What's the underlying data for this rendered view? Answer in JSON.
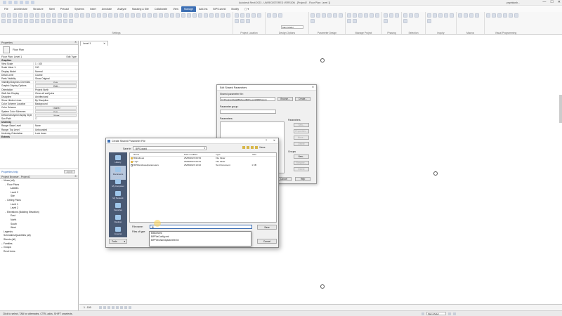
{
  "titlebar": {
    "title": "Autodesk Revit 2023 - UNREGISTERED VERSION - [Project2 - Floor Plan: Level 1]",
    "user": "pspinkosh...",
    "win_min": "—",
    "win_max": "☐",
    "win_close": "✕"
  },
  "ribbon_tabs": [
    "File",
    "Architecture",
    "Structure",
    "Steel",
    "Precast",
    "Systems",
    "Insert",
    "Annotate",
    "Analyze",
    "Massing & Site",
    "Collaborate",
    "View",
    "Manage",
    "Add-Ins",
    "BIPS-world",
    "Modify",
    "▢ ▾"
  ],
  "ribbon_active_tab": "Manage",
  "ribbon_groups": [
    {
      "label": "Settings"
    },
    {
      "label": "Project Location"
    },
    {
      "label": "Design Options"
    },
    {
      "label": "Parameter Design"
    },
    {
      "label": "Manage Project"
    },
    {
      "label": "Phasing"
    },
    {
      "label": "Selection"
    },
    {
      "label": "Inquiry"
    },
    {
      "label": "Macros"
    },
    {
      "label": "Visual Programming"
    }
  ],
  "ribbon_main_model": "Main Model",
  "properties": {
    "header": "Properties",
    "close": "✕",
    "type_name": "Floor Plan",
    "filter": "Floor Plan: Level 1",
    "edit_type": "Edit Type",
    "rows": [
      {
        "k": "Graphics",
        "v": "",
        "cat": true
      },
      {
        "k": "View Scale",
        "v": "1 : 100"
      },
      {
        "k": "Scale Value 1:",
        "v": "100"
      },
      {
        "k": "Display Model",
        "v": "Normal"
      },
      {
        "k": "Detail Level",
        "v": "Coarse"
      },
      {
        "k": "Parts Visibility",
        "v": "Show Original"
      },
      {
        "k": "Visibility/Graphics Overrides",
        "v": "Edit...",
        "btn": true
      },
      {
        "k": "Graphic Display Options",
        "v": "Edit...",
        "btn": true
      },
      {
        "k": "Orientation",
        "v": "Project North"
      },
      {
        "k": "Wall Join Display",
        "v": "Clean all wall joins"
      },
      {
        "k": "Discipline",
        "v": "Architectural"
      },
      {
        "k": "Show Hidden Lines",
        "v": "By Discipline"
      },
      {
        "k": "Color Scheme Location",
        "v": "Background"
      },
      {
        "k": "Color Scheme",
        "v": "<none>",
        "btn": true
      },
      {
        "k": "System Color Schemes",
        "v": "Edit...",
        "btn": true
      },
      {
        "k": "Default Analysis Display Style",
        "v": "None",
        "btn": true
      },
      {
        "k": "Sun Path",
        "v": "☐"
      },
      {
        "k": "Underlay",
        "v": "",
        "cat": true
      },
      {
        "k": "Range: Base Level",
        "v": "None"
      },
      {
        "k": "Range: Top Level",
        "v": "Unbounded"
      },
      {
        "k": "Underlay Orientation",
        "v": "Look down"
      },
      {
        "k": "Extents",
        "v": "",
        "cat": true
      }
    ],
    "help": "Properties help",
    "apply": "Apply"
  },
  "browser": {
    "header": "Project Browser - Project2",
    "close": "✕",
    "nodes": [
      {
        "t": "Views (all)",
        "d": 0,
        "g": "−"
      },
      {
        "t": "Floor Plans",
        "d": 1,
        "g": "−"
      },
      {
        "t": "Level 1",
        "d": 2,
        "g": "",
        "bold": true
      },
      {
        "t": "Level 2",
        "d": 2,
        "g": ""
      },
      {
        "t": "Site",
        "d": 2,
        "g": ""
      },
      {
        "t": "Ceiling Plans",
        "d": 1,
        "g": "−"
      },
      {
        "t": "Level 1",
        "d": 2,
        "g": ""
      },
      {
        "t": "Level 2",
        "d": 2,
        "g": ""
      },
      {
        "t": "Elevations (Building Elevation)",
        "d": 1,
        "g": "−"
      },
      {
        "t": "East",
        "d": 2,
        "g": ""
      },
      {
        "t": "North",
        "d": 2,
        "g": ""
      },
      {
        "t": "South",
        "d": 2,
        "g": ""
      },
      {
        "t": "West",
        "d": 2,
        "g": ""
      },
      {
        "t": "Legends",
        "d": 0,
        "g": ""
      },
      {
        "t": "Schedules/Quantities (all)",
        "d": 0,
        "g": ""
      },
      {
        "t": "Sheets (all)",
        "d": 0,
        "g": ""
      },
      {
        "t": "Families",
        "d": 0,
        "g": "+"
      },
      {
        "t": "Groups",
        "d": 0,
        "g": "+"
      },
      {
        "t": "Revit Links",
        "d": 0,
        "g": ""
      }
    ]
  },
  "view_tab": {
    "label": "Level 1",
    "close": "✕"
  },
  "viewbar": {
    "scale": "1 : 100"
  },
  "statusbar": {
    "message": "Click to select, TAB for alternates, CTRL adds, SHIFT unselects.",
    "model": "Main Model"
  },
  "edit_shared": {
    "title": "Edit Shared Parameters",
    "close": "✕",
    "file_label": "Shared parameter file:",
    "file_value": "C:\\ProgramData\\BIMsoupBIPs-world\\BIPs\\mm\\",
    "browse": "Browse...",
    "create": "Create...",
    "group_label": "Parameter group:",
    "params_label": "Parameters:",
    "parameters_section": "Parameters",
    "btn_new": "New...",
    "btn_properties": "Properties...",
    "btn_move": "Move...",
    "btn_delete": "Delete",
    "groups_section": "Groups",
    "btn_gnew": "New...",
    "btn_rename": "Rename...",
    "btn_gdelete": "Delete",
    "cancel": "Cancel",
    "help": "Help"
  },
  "create_file": {
    "title": "Create Shared Parameter File",
    "help": "?",
    "close": "✕",
    "save_in_label": "Save in:",
    "save_in": "BIPS-world",
    "views": "Views",
    "places": [
      "History",
      "Documents",
      "My Computer",
      "My Network",
      "Favorites",
      "Desktop",
      "Imperial"
    ],
    "columns": [
      "Name",
      "Date modified",
      "Type",
      "Size"
    ],
    "files": [
      {
        "name": "Bibliotheek",
        "date": "25/08/2023 09:54",
        "type": "File folder",
        "size": "",
        "kind": "folder"
      },
      {
        "name": "Logs",
        "date": "25/08/2023 09:51",
        "type": "File folder",
        "size": "",
        "kind": "folder"
      },
      {
        "name": "BIPFile/sharedparameters",
        "date": "25/08/2023 10:02",
        "type": "Text Document",
        "size": "1 KB",
        "kind": "doc"
      }
    ],
    "filename_label": "File name:",
    "filename_value": "Bi",
    "filetype_label": "Files of type:",
    "save": "Save",
    "cancel": "Cancel",
    "tools": "Tools"
  },
  "autocomplete": [
    "Bibliotheek",
    "BIPFileConfig.xml",
    "BIPFile/sharedparameter.txt"
  ]
}
